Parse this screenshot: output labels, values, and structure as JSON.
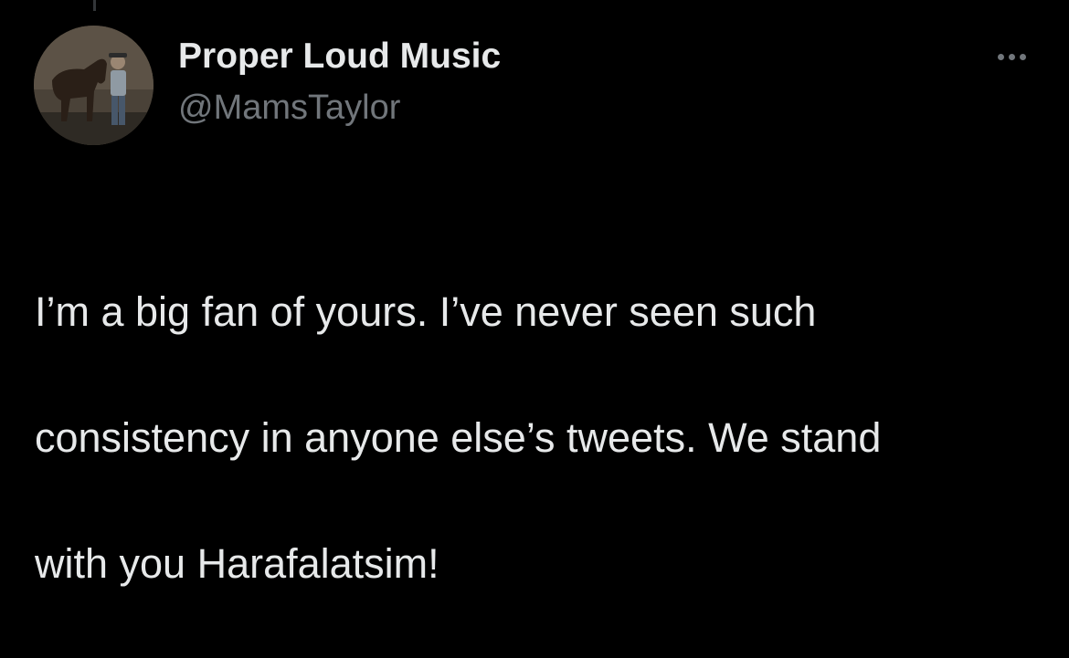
{
  "author": {
    "display_name": "Proper Loud Music",
    "handle": "@MamsTaylor",
    "avatar_icon": "profile-photo-man-with-horse"
  },
  "tweet": {
    "lines": [
      "I’m a big fan of yours. I’ve never seen such",
      "consistency in anyone else’s tweets. We stand",
      "with you Harafalatsim!"
    ]
  },
  "actions": {
    "more_icon": "more-horizontal-icon"
  },
  "colors": {
    "background": "#000000",
    "primary_text": "#e7e9ea",
    "secondary_text": "#71767b"
  }
}
